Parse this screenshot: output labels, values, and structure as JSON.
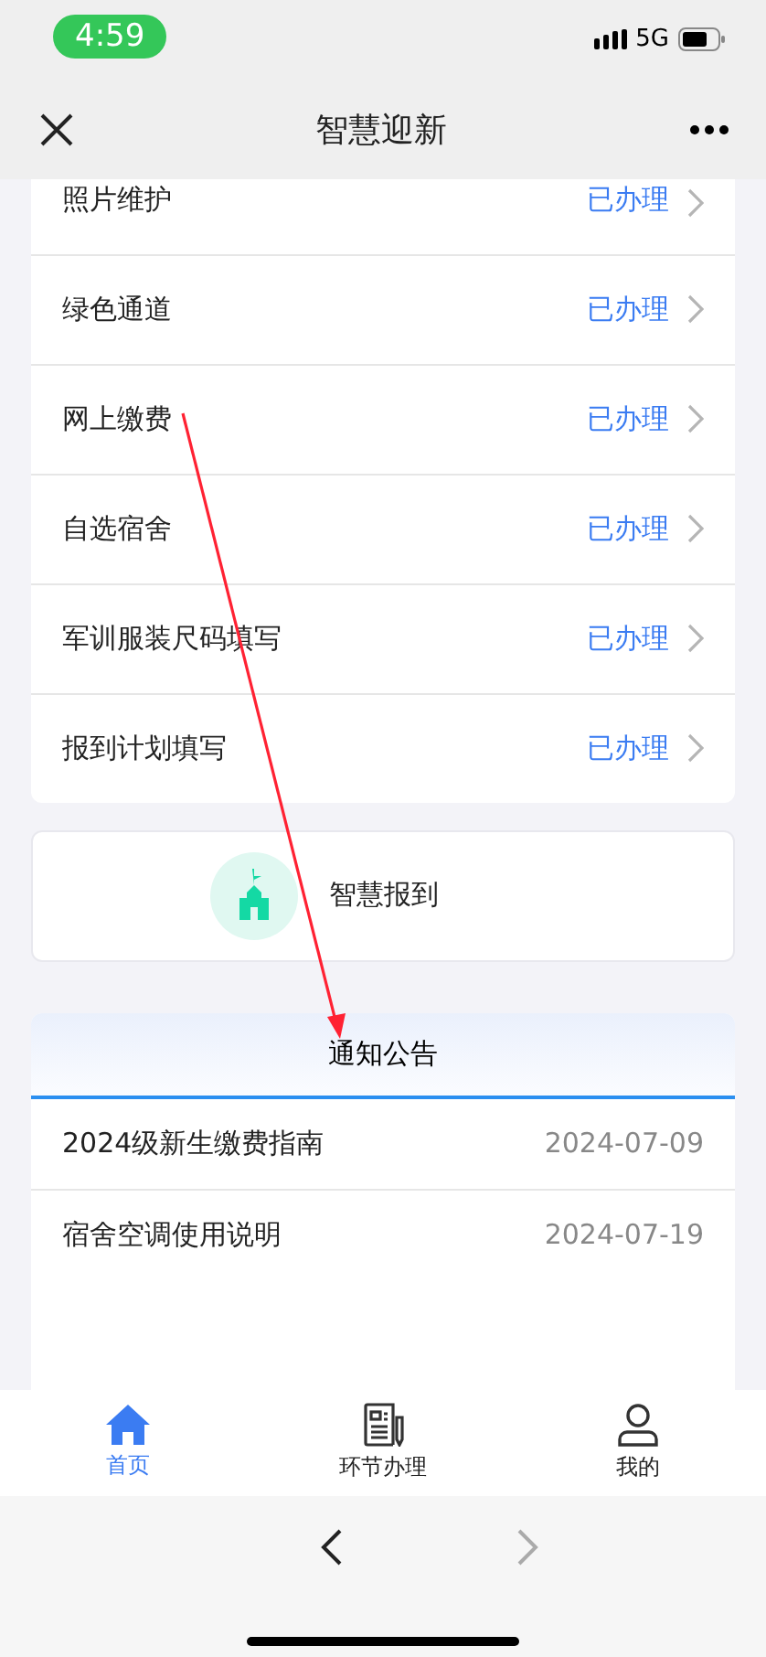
{
  "status_bar": {
    "time": "4:59",
    "network": "5G"
  },
  "nav_bar": {
    "title": "智慧迎新"
  },
  "steps": [
    {
      "label": "照片维护",
      "status": "已办理"
    },
    {
      "label": "绿色通道",
      "status": "已办理"
    },
    {
      "label": "网上缴费",
      "status": "已办理"
    },
    {
      "label": "自选宿舍",
      "status": "已办理"
    },
    {
      "label": "军训服装尺码填写",
      "status": "已办理"
    },
    {
      "label": "报到计划填写",
      "status": "已办理"
    }
  ],
  "checkin_card": {
    "label": "智慧报到"
  },
  "notices": {
    "title": "通知公告",
    "items": [
      {
        "title": "2024级新生缴费指南",
        "date": "2024-07-09"
      },
      {
        "title": "宿舍空调使用说明",
        "date": "2024-07-19"
      }
    ]
  },
  "tab_bar": [
    {
      "label": "首页",
      "kind": "home",
      "selected": true
    },
    {
      "label": "环节办理",
      "kind": "form",
      "selected": false
    },
    {
      "label": "我的",
      "kind": "profile",
      "selected": false
    }
  ],
  "browser_nav": {
    "back_disabled": false,
    "forward_disabled": true
  }
}
